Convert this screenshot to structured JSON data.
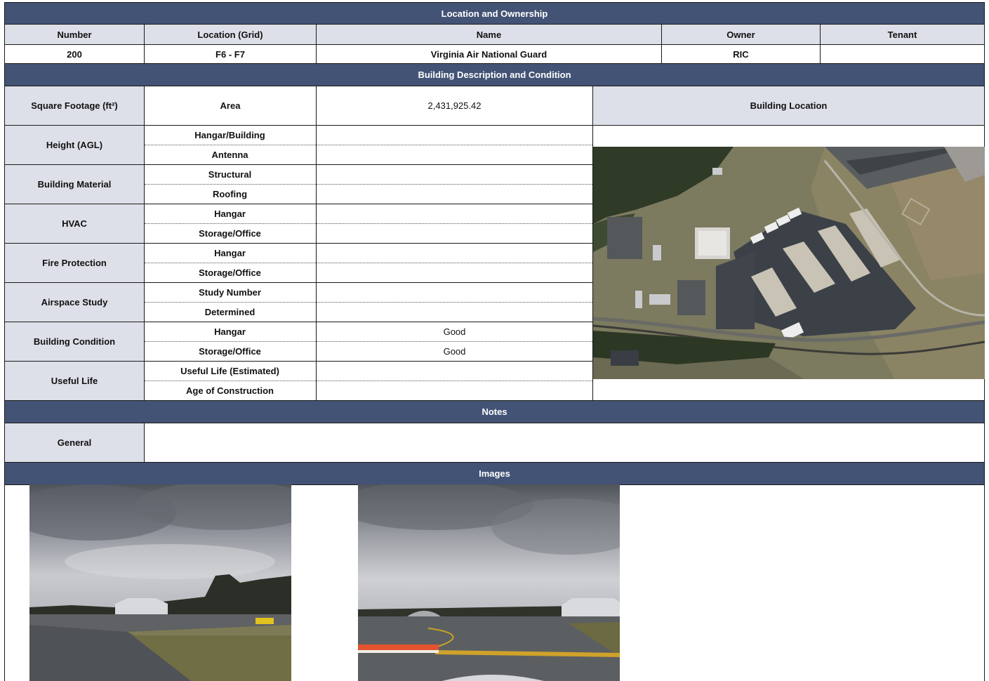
{
  "sections": {
    "location": "Location and Ownership",
    "description": "Building Description and Condition",
    "notes": "Notes",
    "images": "Images"
  },
  "ownership": {
    "headers": [
      "Number",
      "Location (Grid)",
      "Name",
      "Owner",
      "Tenant"
    ],
    "values": [
      "200",
      "F6 - F7",
      "Virginia Air National Guard",
      "RIC",
      ""
    ]
  },
  "description": {
    "square_footage_label": "Square Footage (ft²)",
    "area_label": "Area",
    "area_value": "2,431,925.42",
    "building_location_label": "Building Location",
    "groups": [
      {
        "label": "Height (AGL)",
        "rows": [
          {
            "name": "Hangar/Building",
            "value": ""
          },
          {
            "name": "Antenna",
            "value": ""
          }
        ]
      },
      {
        "label": "Building Material",
        "rows": [
          {
            "name": "Structural",
            "value": ""
          },
          {
            "name": "Roofing",
            "value": ""
          }
        ]
      },
      {
        "label": "HVAC",
        "rows": [
          {
            "name": "Hangar",
            "value": ""
          },
          {
            "name": "Storage/Office",
            "value": ""
          }
        ]
      },
      {
        "label": "Fire Protection",
        "rows": [
          {
            "name": "Hangar",
            "value": ""
          },
          {
            "name": "Storage/Office",
            "value": ""
          }
        ]
      },
      {
        "label": "Airspace Study",
        "rows": [
          {
            "name": "Study Number",
            "value": ""
          },
          {
            "name": "Determined",
            "value": ""
          }
        ]
      },
      {
        "label": "Building Condition",
        "rows": [
          {
            "name": "Hangar",
            "value": "Good"
          },
          {
            "name": "Storage/Office",
            "value": "Good"
          }
        ]
      },
      {
        "label": "Useful Life",
        "rows": [
          {
            "name": "Useful Life (Estimated)",
            "value": ""
          },
          {
            "name": "Age of Construction",
            "value": ""
          }
        ]
      }
    ]
  },
  "notes": {
    "general_label": "General",
    "general_value": ""
  },
  "colors": {
    "band": "#435375",
    "header_fill": "#dde0e8"
  }
}
